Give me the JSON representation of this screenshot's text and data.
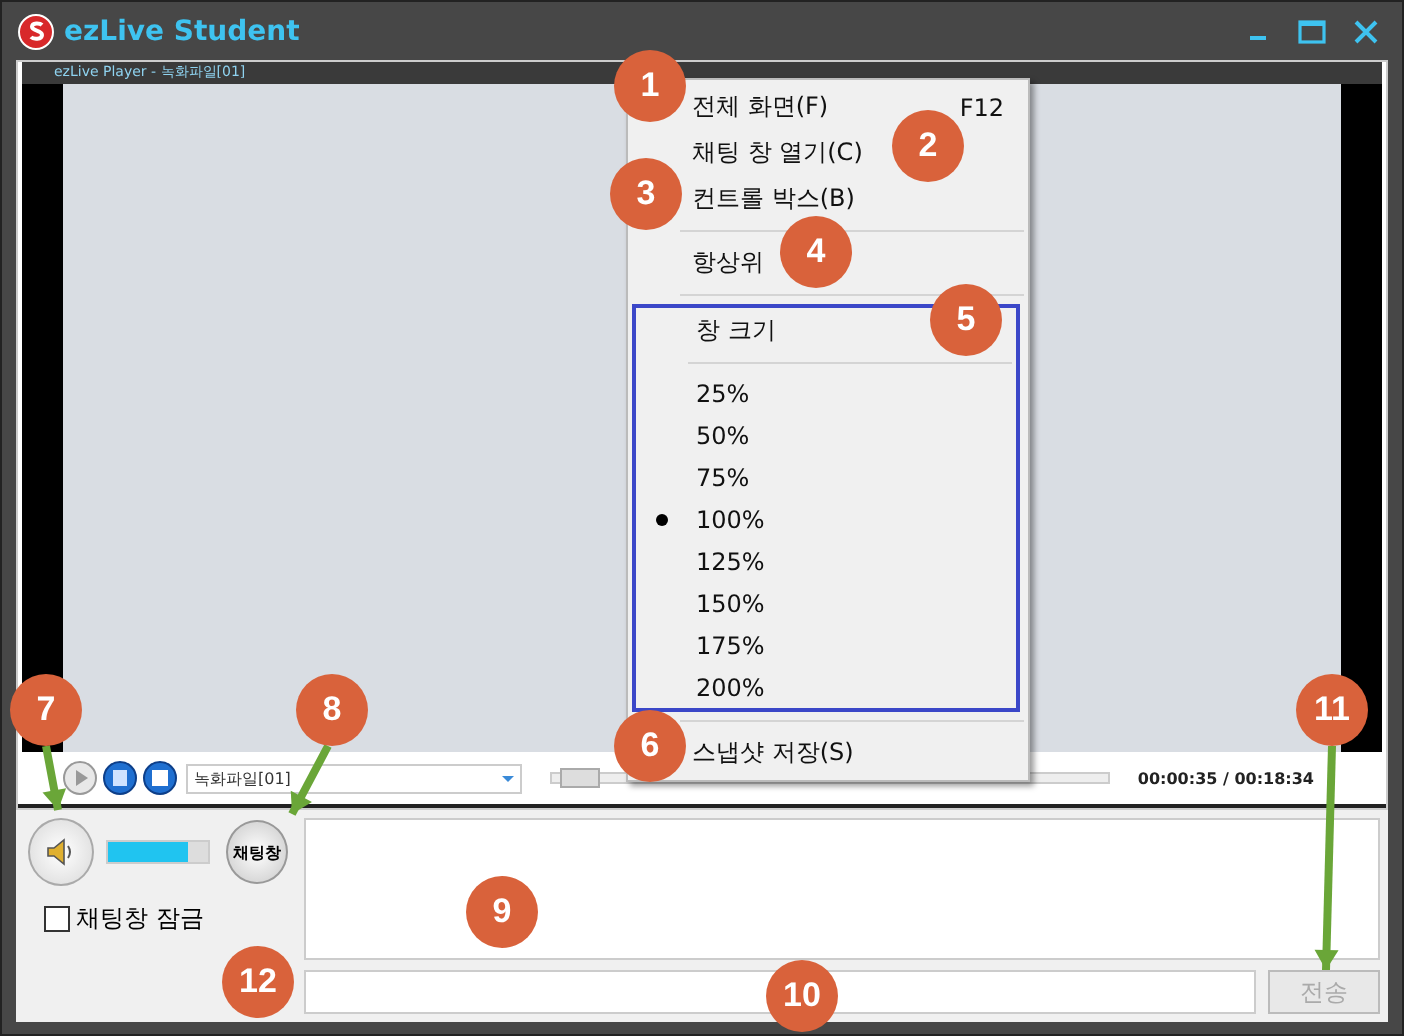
{
  "window": {
    "title": "ezLive Student"
  },
  "player": {
    "title": "ezLive Player - 녹화파일[01]",
    "file_select": "녹화파일[01]",
    "time": "00:00:35 / 00:18:34",
    "seek": {
      "level": 0.03
    }
  },
  "context_menu": {
    "sections": [
      {
        "kind": "items",
        "items": [
          {
            "label": "전체 화면(F)",
            "shortcut": "F12"
          },
          {
            "label": "채팅 창 열기(C)"
          },
          {
            "label": "컨트롤 박스(B)"
          }
        ]
      },
      {
        "kind": "items",
        "items": [
          {
            "label": "항상위"
          }
        ]
      },
      {
        "kind": "size_group",
        "title": "창 크기",
        "options": [
          {
            "label": "25%",
            "selected": false
          },
          {
            "label": "50%",
            "selected": false
          },
          {
            "label": "75%",
            "selected": false
          },
          {
            "label": "100%",
            "selected": true
          },
          {
            "label": "125%",
            "selected": false
          },
          {
            "label": "150%",
            "selected": false
          },
          {
            "label": "175%",
            "selected": false
          },
          {
            "label": "200%",
            "selected": false
          }
        ]
      },
      {
        "kind": "items",
        "items": [
          {
            "label": "스냅샷 저장(S)"
          }
        ]
      }
    ]
  },
  "controls": {
    "volume": {
      "level": 0.8
    },
    "chat_button": "채팅창",
    "lock": {
      "label": "채팅창 잠금",
      "checked": false
    },
    "send_button": {
      "label": "전송",
      "disabled": true
    }
  },
  "callouts": [
    {
      "number": "1",
      "arrow": false
    },
    {
      "number": "2",
      "arrow": false
    },
    {
      "number": "3",
      "arrow": false
    },
    {
      "number": "4",
      "arrow": false
    },
    {
      "number": "5",
      "arrow": false
    },
    {
      "number": "7",
      "arrow": true
    },
    {
      "number": "8",
      "arrow": true
    },
    {
      "number": "6",
      "arrow": false
    },
    {
      "number": "11",
      "arrow": true
    },
    {
      "number": "9",
      "arrow": false
    },
    {
      "number": "12",
      "arrow": false
    },
    {
      "number": "10",
      "arrow": false
    }
  ]
}
